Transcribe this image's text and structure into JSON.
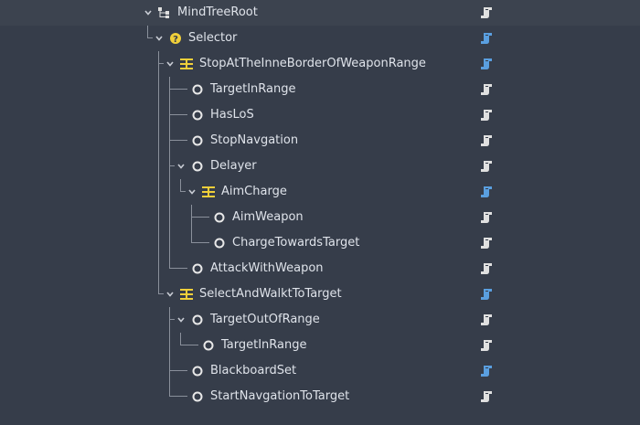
{
  "colors": {
    "background": "#363d4a",
    "text": "#dfe3ea",
    "guide": "#8a909b",
    "script_white": "#e0e0e0",
    "script_blue": "#5a9fe0",
    "sequence_yellow": "#f0cf3a"
  },
  "tree": [
    {
      "label": "MindTreeRoot",
      "icon": "tree-root-icon",
      "expanded": true,
      "script": "white"
    },
    {
      "label": "Selector",
      "icon": "selector-icon",
      "expanded": true,
      "script": "blue"
    },
    {
      "label": "StopAtTheInneBorderOfWeaponRange",
      "icon": "sequence-icon",
      "expanded": true,
      "script": "blue"
    },
    {
      "label": "TargetInRange",
      "icon": "task-icon",
      "expanded": false,
      "script": "white"
    },
    {
      "label": "HasLoS",
      "icon": "task-icon",
      "expanded": false,
      "script": "white"
    },
    {
      "label": "StopNavgation",
      "icon": "task-icon",
      "expanded": false,
      "script": "white"
    },
    {
      "label": "Delayer",
      "icon": "task-icon",
      "expanded": true,
      "script": "white"
    },
    {
      "label": "AimCharge",
      "icon": "sequence-icon",
      "expanded": true,
      "script": "blue"
    },
    {
      "label": "AimWeapon",
      "icon": "task-icon",
      "expanded": false,
      "script": "white"
    },
    {
      "label": "ChargeTowardsTarget",
      "icon": "task-icon",
      "expanded": false,
      "script": "white"
    },
    {
      "label": "AttackWithWeapon",
      "icon": "task-icon",
      "expanded": false,
      "script": "white"
    },
    {
      "label": "SelectAndWalktToTarget",
      "icon": "sequence-icon",
      "expanded": true,
      "script": "blue"
    },
    {
      "label": "TargetOutOfRange",
      "icon": "task-icon",
      "expanded": true,
      "script": "white"
    },
    {
      "label": "TargetInRange",
      "icon": "task-icon",
      "expanded": false,
      "script": "white"
    },
    {
      "label": "BlackboardSet",
      "icon": "task-icon",
      "expanded": false,
      "script": "blue"
    },
    {
      "label": "StartNavgationToTarget",
      "icon": "task-icon",
      "expanded": false,
      "script": "white"
    }
  ]
}
